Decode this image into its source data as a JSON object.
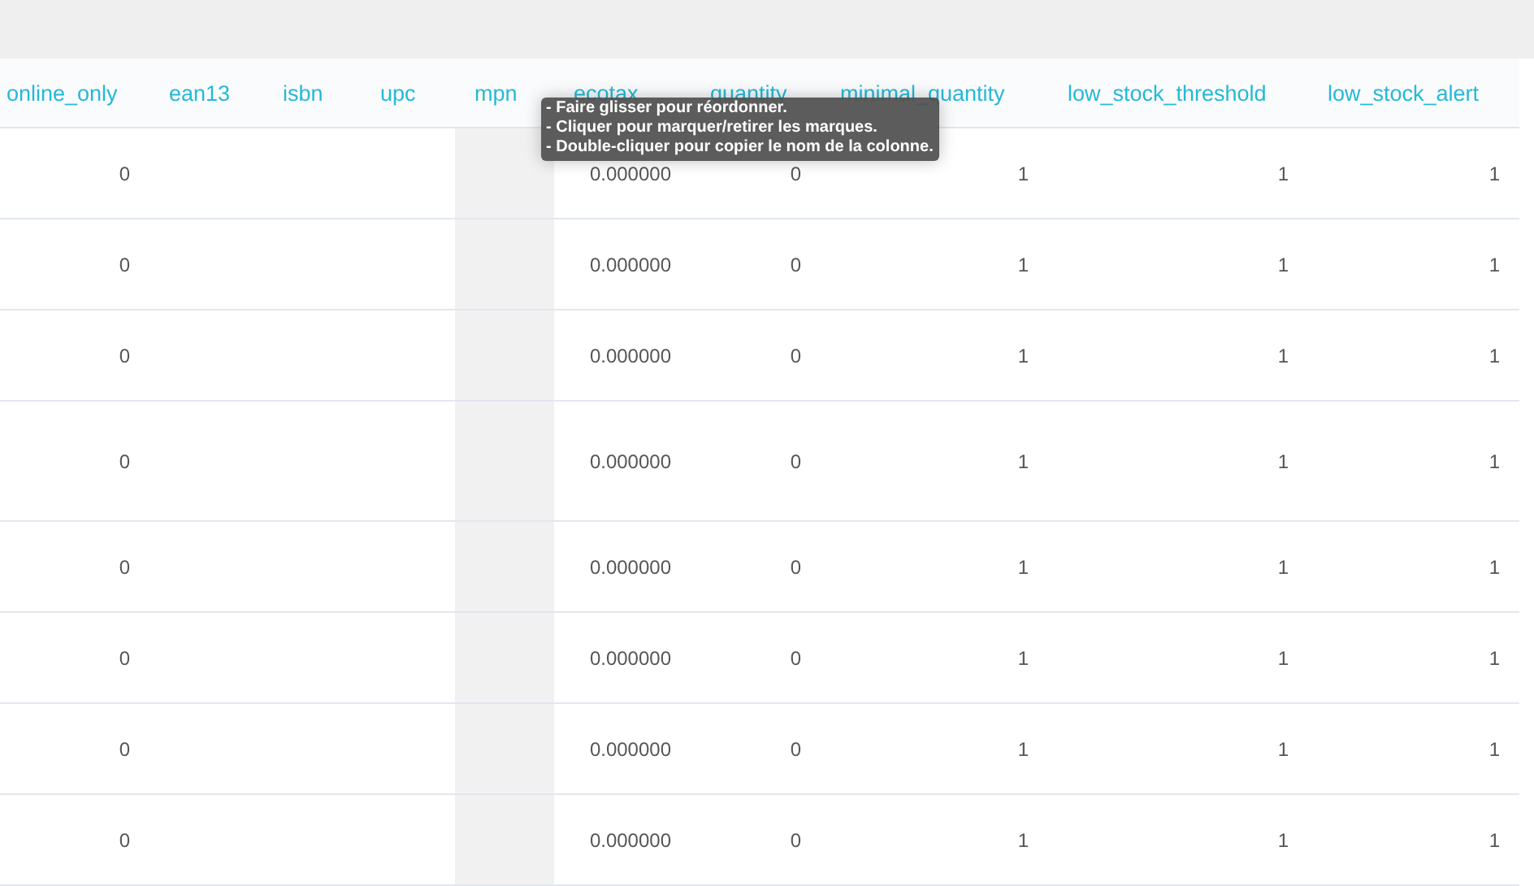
{
  "table": {
    "columns": [
      {
        "label": "online_only",
        "marked": false,
        "cells": [
          "0",
          "0",
          "0",
          "0",
          "0",
          "0",
          "0",
          "0"
        ]
      },
      {
        "label": "ean13",
        "marked": false
      },
      {
        "label": "isbn",
        "marked": false
      },
      {
        "label": "upc",
        "marked": false
      },
      {
        "label": "mpn",
        "marked": true
      },
      {
        "label": "ecotax",
        "marked": false,
        "cells": [
          "0.000000",
          "0.000000",
          "0.000000",
          "0.000000",
          "0.000000",
          "0.000000",
          "0.000000",
          "0.000000"
        ]
      },
      {
        "label": "quantity",
        "marked": false,
        "cells": [
          "0",
          "0",
          "0",
          "0",
          "0",
          "0",
          "0",
          "0"
        ]
      },
      {
        "label": "minimal_quantity",
        "marked": false,
        "cells": [
          "1",
          "1",
          "1",
          "1",
          "1",
          "1",
          "1",
          "1"
        ]
      },
      {
        "label": "low_stock_threshold",
        "marked": false,
        "cells": [
          "1",
          "1",
          "1",
          "1",
          "1",
          "1",
          "1",
          "1"
        ]
      },
      {
        "label": "low_stock_alert",
        "marked": false,
        "cells": [
          "1",
          "1",
          "1",
          "1",
          "1",
          "1",
          "1",
          "1"
        ]
      }
    ]
  },
  "tooltip": {
    "lines": [
      "- Faire glisser pour réordonner.",
      "- Cliquer pour marquer/retirer les marques.",
      "- Double-cliquer pour copier le nom de la colonne."
    ]
  }
}
